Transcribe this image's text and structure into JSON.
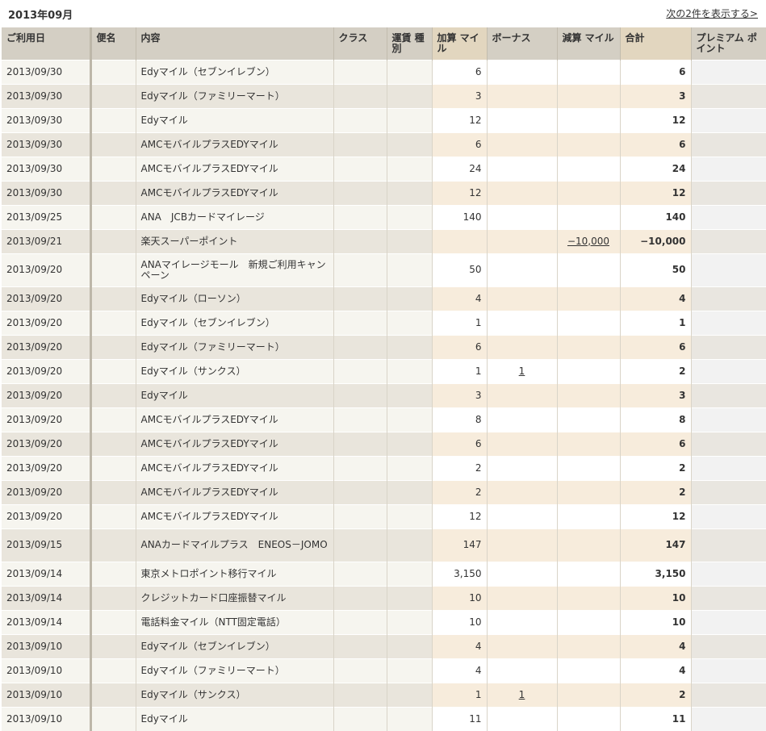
{
  "header": {
    "month": "2013年09月",
    "next_link": "次の2件を表示する>"
  },
  "columns": {
    "date": "ご利用日",
    "flight": "便名",
    "content": "内容",
    "class": "クラス",
    "fare_type": "運賃 種別",
    "add": "加算 マイル",
    "bonus": "ボーナス",
    "sub": "減算 マイル",
    "total": "合計",
    "premium": "プレミアム ポイント"
  },
  "rows": [
    {
      "date": "2013/09/30",
      "content": "Edyマイル（セブンイレブン）",
      "add": "6",
      "bonus": "",
      "sub": "",
      "total": "6"
    },
    {
      "date": "2013/09/30",
      "content": "Edyマイル（ファミリーマート）",
      "add": "3",
      "bonus": "",
      "sub": "",
      "total": "3"
    },
    {
      "date": "2013/09/30",
      "content": "Edyマイル",
      "add": "12",
      "bonus": "",
      "sub": "",
      "total": "12"
    },
    {
      "date": "2013/09/30",
      "content": "AMCモバイルプラスEDYマイル",
      "add": "6",
      "bonus": "",
      "sub": "",
      "total": "6"
    },
    {
      "date": "2013/09/30",
      "content": "AMCモバイルプラスEDYマイル",
      "add": "24",
      "bonus": "",
      "sub": "",
      "total": "24"
    },
    {
      "date": "2013/09/30",
      "content": "AMCモバイルプラスEDYマイル",
      "add": "12",
      "bonus": "",
      "sub": "",
      "total": "12"
    },
    {
      "date": "2013/09/25",
      "content": "ANA　JCBカードマイレージ",
      "add": "140",
      "bonus": "",
      "sub": "",
      "total": "140"
    },
    {
      "date": "2013/09/21",
      "content": "楽天スーパーポイント",
      "add": "",
      "bonus": "",
      "sub": "−10,000",
      "total": "−10,000"
    },
    {
      "date": "2013/09/20",
      "content": "ANAマイレージモール　新規ご利用キャンペーン",
      "add": "50",
      "bonus": "",
      "sub": "",
      "total": "50",
      "tall": true
    },
    {
      "date": "2013/09/20",
      "content": "Edyマイル（ローソン）",
      "add": "4",
      "bonus": "",
      "sub": "",
      "total": "4"
    },
    {
      "date": "2013/09/20",
      "content": "Edyマイル（セブンイレブン）",
      "add": "1",
      "bonus": "",
      "sub": "",
      "total": "1"
    },
    {
      "date": "2013/09/20",
      "content": "Edyマイル（ファミリーマート）",
      "add": "6",
      "bonus": "",
      "sub": "",
      "total": "6"
    },
    {
      "date": "2013/09/20",
      "content": "Edyマイル（サンクス）",
      "add": "1",
      "bonus": "1",
      "sub": "",
      "total": "2"
    },
    {
      "date": "2013/09/20",
      "content": "Edyマイル",
      "add": "3",
      "bonus": "",
      "sub": "",
      "total": "3"
    },
    {
      "date": "2013/09/20",
      "content": "AMCモバイルプラスEDYマイル",
      "add": "8",
      "bonus": "",
      "sub": "",
      "total": "8"
    },
    {
      "date": "2013/09/20",
      "content": "AMCモバイルプラスEDYマイル",
      "add": "6",
      "bonus": "",
      "sub": "",
      "total": "6"
    },
    {
      "date": "2013/09/20",
      "content": "AMCモバイルプラスEDYマイル",
      "add": "2",
      "bonus": "",
      "sub": "",
      "total": "2"
    },
    {
      "date": "2013/09/20",
      "content": "AMCモバイルプラスEDYマイル",
      "add": "2",
      "bonus": "",
      "sub": "",
      "total": "2"
    },
    {
      "date": "2013/09/20",
      "content": "AMCモバイルプラスEDYマイル",
      "add": "12",
      "bonus": "",
      "sub": "",
      "total": "12"
    },
    {
      "date": "2013/09/15",
      "content": "ANAカードマイルプラス　ENEOS－JOMO",
      "add": "147",
      "bonus": "",
      "sub": "",
      "total": "147",
      "tall": true
    },
    {
      "date": "2013/09/14",
      "content": "東京メトロポイント移行マイル",
      "add": "3,150",
      "bonus": "",
      "sub": "",
      "total": "3,150"
    },
    {
      "date": "2013/09/14",
      "content": "クレジットカード口座振替マイル",
      "add": "10",
      "bonus": "",
      "sub": "",
      "total": "10"
    },
    {
      "date": "2013/09/14",
      "content": "電話料金マイル（NTT固定電話）",
      "add": "10",
      "bonus": "",
      "sub": "",
      "total": "10"
    },
    {
      "date": "2013/09/10",
      "content": "Edyマイル（セブンイレブン）",
      "add": "4",
      "bonus": "",
      "sub": "",
      "total": "4"
    },
    {
      "date": "2013/09/10",
      "content": "Edyマイル（ファミリーマート）",
      "add": "4",
      "bonus": "",
      "sub": "",
      "total": "4"
    },
    {
      "date": "2013/09/10",
      "content": "Edyマイル（サンクス）",
      "add": "1",
      "bonus": "1",
      "sub": "",
      "total": "2"
    },
    {
      "date": "2013/09/10",
      "content": "Edyマイル",
      "add": "11",
      "bonus": "",
      "sub": "",
      "total": "11"
    }
  ]
}
